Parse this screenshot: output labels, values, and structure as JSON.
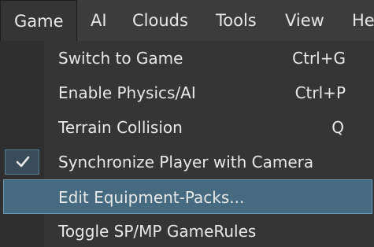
{
  "menubar": {
    "items": [
      {
        "label": "Game",
        "active": true
      },
      {
        "label": "AI"
      },
      {
        "label": "Clouds"
      },
      {
        "label": "Tools"
      },
      {
        "label": "View"
      },
      {
        "label": "He"
      }
    ]
  },
  "dropdown": {
    "items": [
      {
        "label": "Switch to Game",
        "shortcut": "Ctrl+G"
      },
      {
        "label": "Enable Physics/AI",
        "shortcut": "Ctrl+P"
      },
      {
        "label": "Terrain Collision",
        "shortcut": "Q"
      },
      {
        "label": "Synchronize Player with Camera",
        "checked": true,
        "check_icon": "checkmark-icon"
      },
      {
        "label": "Edit Equipment-Packs...",
        "highlighted": true
      },
      {
        "label": "Toggle SP/MP GameRules"
      }
    ]
  },
  "colors": {
    "menubar_bg": "#3c3c3c",
    "menu_bg": "#353535",
    "highlight_bg": "#466a80",
    "highlight_border": "#6a9ab8",
    "text": "#e8e8e8"
  }
}
